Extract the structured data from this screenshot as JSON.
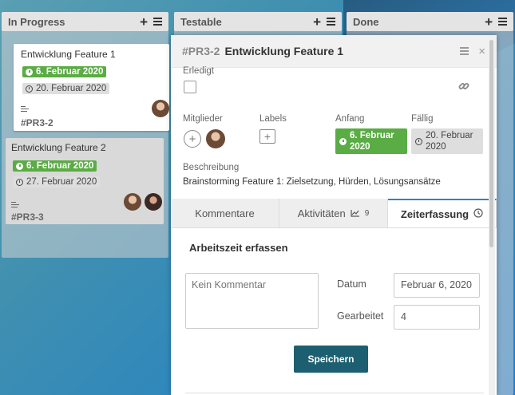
{
  "lists": [
    {
      "title": "In Progress"
    },
    {
      "title": "Testable"
    },
    {
      "title": "Done"
    }
  ],
  "cards": [
    {
      "title": "Entwicklung Feature 1",
      "start": "6. Februar 2020",
      "due": "20. Februar 2020",
      "id": "#PR3-2"
    },
    {
      "title": "Entwicklung Feature 2",
      "start": "6. Februar 2020",
      "due": "27. Februar 2020",
      "id": "#PR3-3"
    }
  ],
  "detail": {
    "id": "#PR3-2",
    "title": "Entwicklung Feature 1",
    "done_label": "Erledigt",
    "members_label": "Mitglieder",
    "labels_label": "Labels",
    "start_label": "Anfang",
    "start_value": "6. Februar 2020",
    "due_label": "Fällig",
    "due_value": "20. Februar 2020",
    "description_label": "Beschreibung",
    "description": "Brainstorming Feature 1: Zielsetzung, Hürden, Lösungsansätze",
    "tabs": {
      "comments": "Kommentare",
      "activities": "Aktivitäten",
      "activities_count": "9",
      "time": "Zeiterfassung"
    },
    "time_tracking": {
      "heading": "Arbeitszeit erfassen",
      "comment_placeholder": "Kein Kommentar",
      "date_label": "Datum",
      "date_value": "Februar 6, 2020",
      "worked_label": "Gearbeitet",
      "worked_value": "4",
      "save_label": "Speichern"
    }
  },
  "colors": {
    "accent_green": "#5aac44",
    "save_button": "#1c5f70"
  }
}
